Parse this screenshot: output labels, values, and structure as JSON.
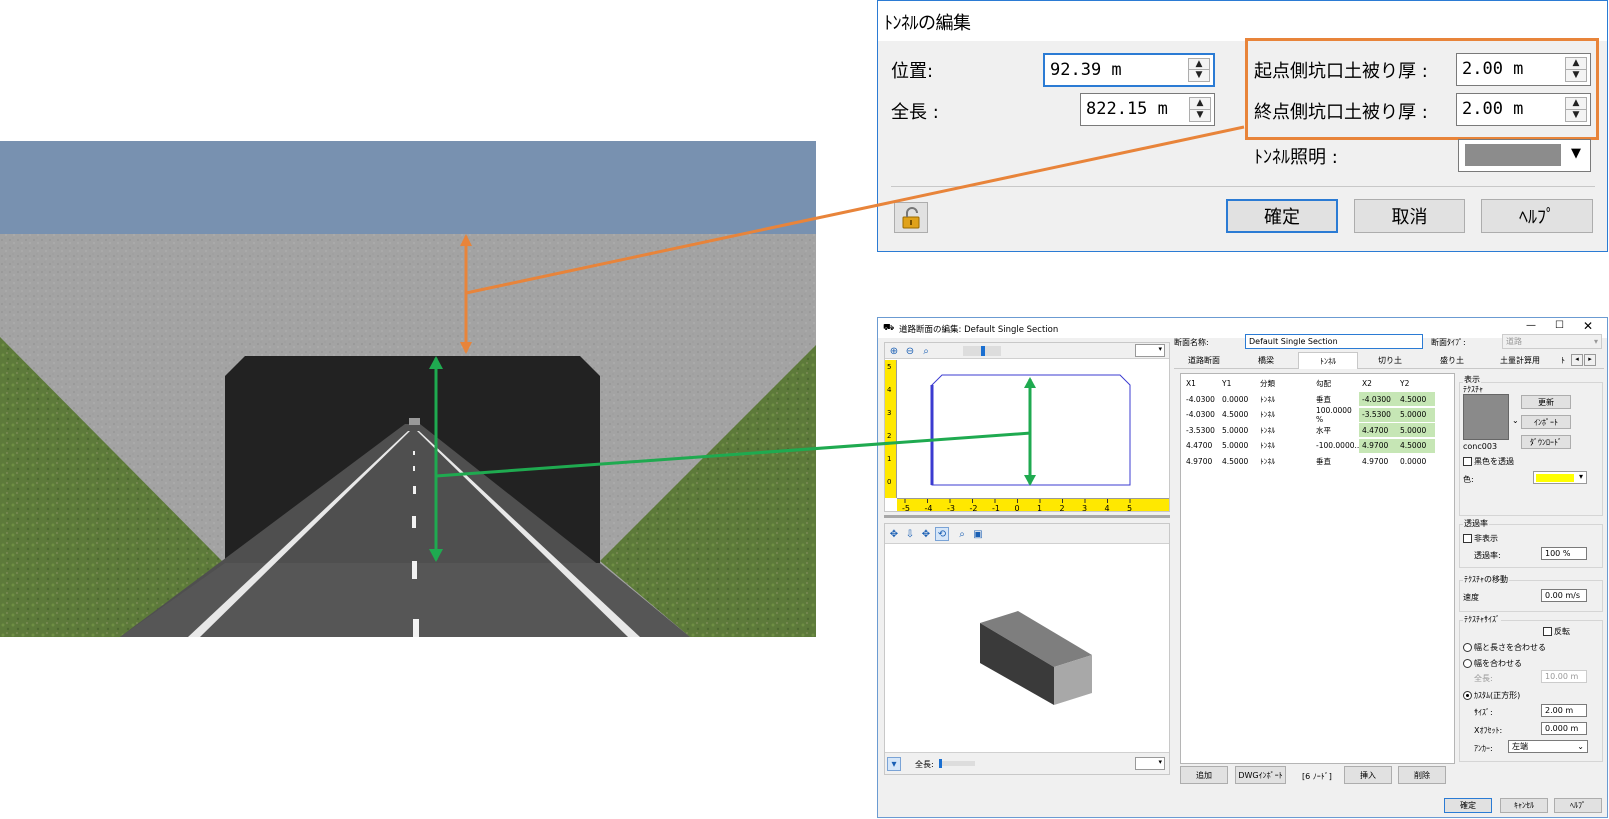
{
  "tunnel_dialog": {
    "title": "ﾄﾝﾈﾙの編集",
    "position_label": "位置:",
    "position_value": "92.39 m",
    "length_label": "全長 :",
    "length_value": "822.15 m",
    "start_cover_label": "起点側坑口土被り厚 :",
    "start_cover_value": "2.00 m",
    "end_cover_label": "終点側坑口土被り厚 :",
    "end_cover_value": "2.00 m",
    "lighting_label": "ﾄﾝﾈﾙ照明 :",
    "ok_label": "確定",
    "cancel_label": "取消",
    "help_label": "ﾍﾙﾌﾟ",
    "colors": {
      "highlight": "#e8843a",
      "lighting_swatch": "#8c8c8c"
    }
  },
  "section_dialog": {
    "title": "道路断面の編集: Default Single Section",
    "section_name_label": "断面名称:",
    "section_name_value": "Default Single Section",
    "section_type_label": "断面ﾀｲﾌﾟ:",
    "section_type_value": "道路",
    "tabs": [
      "道路断面",
      "橋梁",
      "ﾄﾝﾈﾙ",
      "切り土",
      "盛り土",
      "土量計算用",
      "ﾄ"
    ],
    "active_tab": "ﾄﾝﾈﾙ",
    "table_headers": [
      "X1",
      "Y1",
      "分類",
      "勾配",
      "X2",
      "Y2"
    ],
    "rows": [
      [
        "-4.0300",
        "0.0000",
        "ﾄﾝﾈﾙ",
        "垂直",
        "-4.0300",
        "4.5000"
      ],
      [
        "-4.0300",
        "4.5000",
        "ﾄﾝﾈﾙ",
        "100.0000 %",
        "-3.5300",
        "5.0000"
      ],
      [
        "-3.5300",
        "5.0000",
        "ﾄﾝﾈﾙ",
        "水平",
        "4.4700",
        "5.0000"
      ],
      [
        "4.4700",
        "5.0000",
        "ﾄﾝﾈﾙ",
        "-100.0000...",
        "4.9700",
        "4.5000"
      ],
      [
        "4.9700",
        "4.5000",
        "ﾄﾝﾈﾙ",
        "垂直",
        "4.9700",
        "0.0000"
      ]
    ],
    "bottom_buttons": {
      "add": "追加",
      "dwg_import": "DWGｲﾝﾎﾟｰﾄ",
      "node_count": "[6 ﾉｰﾄﾞ]",
      "insert": "挿入",
      "delete": "削除"
    },
    "display_group": "表示",
    "texture_label": "ﾃｸｽﾁｬ",
    "texture_name": "conc003",
    "update_button": "更新",
    "import_button": "ｲﾝﾎﾟｰﾄ",
    "download_button": "ﾀﾞｳﾝﾛｰﾄﾞ",
    "black_transparent_label": "黒色を透過",
    "color_label": "色:",
    "color_value": "#ffff00",
    "transparency_group": "透過率",
    "hide_label": "非表示",
    "transparency_label": "透過率:",
    "transparency_value": "100 %",
    "texture_move_group": "ﾃｸｽﾁｬの移動",
    "speed_label": "速度",
    "speed_value": "0.00 m/s",
    "texture_size_group": "ﾃｸｽﾁｬｻｲｽﾞ",
    "reverse_label": "反転",
    "fit_width_length": "幅と長さを合わせる",
    "fit_width": "幅を合わせる",
    "full_length_label": "全長:",
    "full_length_value": "10.00 m",
    "custom_square": "ｶｽﾀﾑ(正方形)",
    "size_label": "ｻｲｽﾞ:",
    "size_value": "2.00 m",
    "xoffset_label": "Xｵﾌｾｯﾄ:",
    "xoffset_value": "0.000 m",
    "anchor_label": "ｱﾝｶｰ:",
    "anchor_value": "左端",
    "ok_label": "確定",
    "cancel_label": "ｷｬﾝｾﾙ",
    "help_label": "ﾍﾙﾌﾟ",
    "preview_total_label": "全長:",
    "ruler_x_ticks": [
      "-5",
      "-4",
      "-3",
      "-2",
      "-1",
      "0",
      "1",
      "2",
      "3",
      "4",
      "5"
    ],
    "ruler_y_ticks": [
      "5",
      "4",
      "3",
      "2",
      "1",
      "0"
    ]
  },
  "annotation_colors": {
    "cover": "#e8843a",
    "height": "#1faa50"
  }
}
